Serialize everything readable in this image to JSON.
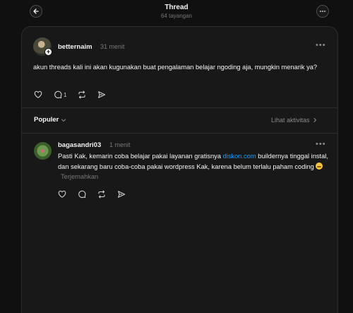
{
  "header": {
    "title": "Thread",
    "views": "64 tayangan"
  },
  "post": {
    "username": "betternaim",
    "time": "31 menit",
    "text": "akun threads kali ini akan kugunakan buat pengalaman belajar ngoding aja, mungkin menarik ya?",
    "reply_count": "1"
  },
  "replies_bar": {
    "sort_label": "Populer",
    "activity_label": "Lihat aktivitas"
  },
  "reply": {
    "username": "bagasandri03",
    "time": "1 menit",
    "text_before_link": "Pasti Kak, kemarin coba belajar pakai layanan gratisnya ",
    "link_text": "diskon.com",
    "text_after_link": " buildernya tinggal instal, dan sekarang baru coba-coba pakai wordpress Kak, karena belum terlalu paham coding ",
    "translate_label": "Terjemahkan"
  },
  "icons": [
    "back-arrow-icon",
    "more-icon",
    "plus-icon",
    "heart-icon",
    "comment-icon",
    "repost-icon",
    "share-icon",
    "chevron-down-icon",
    "chevron-right-icon",
    "grimace-emoji-icon"
  ],
  "colors": {
    "background": "#101010",
    "card": "#181818",
    "link": "#1d9bf0",
    "muted": "#777777"
  }
}
